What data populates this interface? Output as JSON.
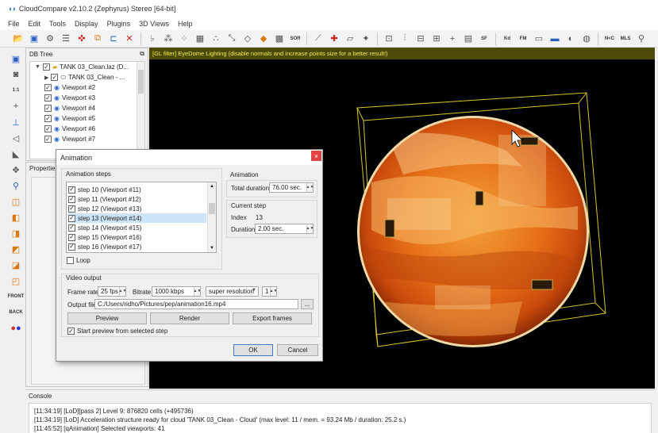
{
  "window": {
    "title": "CloudCompare v2.10.2 (Zephyrus) Stereo [64-bit]"
  },
  "menu": [
    "File",
    "Edit",
    "Tools",
    "Display",
    "Plugins",
    "3D Views",
    "Help"
  ],
  "toolbar_labels": {
    "sor": "SOR",
    "sf": "SF",
    "kd": "Kd",
    "fm": "FM",
    "nc": "N<C",
    "mls": "MLS",
    "front": "FRONT",
    "back": "BACK",
    "scale": "1:1"
  },
  "dbtree": {
    "title": "DB Tree",
    "items": [
      {
        "label": "TANK 03_Clean.laz (D...",
        "kind": "file"
      },
      {
        "label": "TANK 03_Clean - ...",
        "kind": "cloud"
      },
      {
        "label": "Viewport #2",
        "kind": "viewport"
      },
      {
        "label": "Viewport #3",
        "kind": "viewport"
      },
      {
        "label": "Viewport #4",
        "kind": "viewport"
      },
      {
        "label": "Viewport #5",
        "kind": "viewport"
      },
      {
        "label": "Viewport #6",
        "kind": "viewport"
      },
      {
        "label": "Viewport #7",
        "kind": "viewport"
      }
    ]
  },
  "properties": {
    "title": "Properties"
  },
  "view3d": {
    "gl_message": "[GL filter] EyeDome Lighting (disable normals and increase points size for a better result!)"
  },
  "console": {
    "title": "Console",
    "lines": [
      "[11:34:19] [LoD][pass 2] Level 9: 876820 cells (+495736)",
      "[11:34:19] [LoD] Acceleration structure ready for cloud 'TANK 03_Clean - Cloud' (max level: 11 / mem. = 93.24 Mb / duration: 25.2 s.)",
      "[11:45:52] [qAnimation] Selected viewports: 41"
    ]
  },
  "dialog": {
    "title": "Animation",
    "close_label": "×",
    "animation_steps_label": "Animation steps",
    "steps": [
      {
        "label": "step 10 (Viewport #11)",
        "checked": true
      },
      {
        "label": "step 11 (Viewport #12)",
        "checked": true
      },
      {
        "label": "step 12 (Viewport #13)",
        "checked": true
      },
      {
        "label": "step 13 (Viewport #14)",
        "checked": true
      },
      {
        "label": "step 14 (Viewport #15)",
        "checked": true
      },
      {
        "label": "step 15 (Viewport #16)",
        "checked": true
      },
      {
        "label": "step 16 (Viewport #17)",
        "checked": true
      }
    ],
    "loop_label": "Loop",
    "animation_group_label": "Animation",
    "total_duration_label": "Total duration",
    "total_duration_value": "76.00 sec.",
    "current_step_label": "Current step",
    "index_label": "Index",
    "index_value": "13",
    "duration_label": "Duration",
    "duration_value": "2.00 sec.",
    "video_output_label": "Video output",
    "frame_rate_label": "Frame rate",
    "frame_rate_value": "25 fps",
    "bitrate_label": "Bitrate",
    "bitrate_value": "1000 kbps",
    "resolution_value": "super resolution",
    "resolution_factor": "1",
    "output_file_label": "Output file",
    "output_file_value": "C:/Users/ridho/Pictures/pep/animation16.mp4",
    "browse_label": "...",
    "preview_label": "Preview",
    "render_label": "Render",
    "export_frames_label": "Export frames",
    "start_preview_label": "Start preview from selected step",
    "ok_label": "OK",
    "cancel_label": "Cancel"
  },
  "colors": {
    "gl_bar_bg": "#4c4b0b",
    "gl_bar_text": "#f2e94a",
    "selection": "#cce4f7",
    "cloud_base": "#e8731a"
  }
}
